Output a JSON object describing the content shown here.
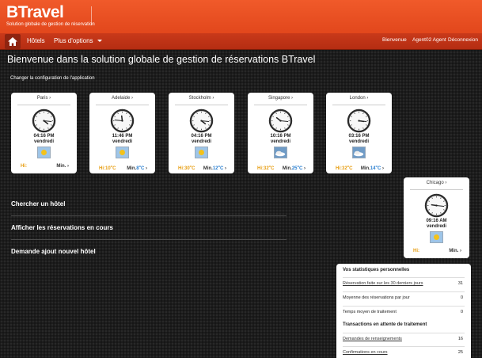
{
  "header": {
    "logo_text": "BTravel",
    "logo_tagline": "Solution globale de gestion de réservation"
  },
  "nav": {
    "hotels": "Hôtels",
    "more": "Plus d'options",
    "welcome": "Bienvenue",
    "user": "Agent02 Agent",
    "logout": "Déconnexion"
  },
  "page": {
    "title": "Bienvenue dans la solution globale de gestion de réservations BTravel",
    "config_link": "Changer la configuration de l'application"
  },
  "clocks": [
    {
      "city": "Paris",
      "time": "04:16 PM",
      "day": "vendredi",
      "hi": "Hi:",
      "min": "Min.",
      "hour": 4,
      "minute": 16,
      "weather": "sun-icon"
    },
    {
      "city": "Adelaide",
      "time": "11:46 PM",
      "day": "vendredi",
      "hi": "Hi:10",
      "min": "Min.8",
      "hour": 11,
      "minute": 46,
      "weather": "moon-icon"
    },
    {
      "city": "Stockholm",
      "time": "04:16 PM",
      "day": "vendredi",
      "hi": "Hi:30",
      "min": "Min.12",
      "hour": 4,
      "minute": 16,
      "weather": "sun-icon"
    },
    {
      "city": "Singapore",
      "time": "10:16 PM",
      "day": "vendredi",
      "hi": "Hi:32",
      "min": "Min.25",
      "hour": 10,
      "minute": 16,
      "weather": "cloud-icon"
    },
    {
      "city": "London",
      "time": "03:16 PM",
      "day": "vendredi",
      "hi": "Hi:32",
      "min": "Min.14",
      "hour": 3,
      "minute": 16,
      "weather": "cloud-icon"
    },
    {
      "city": "Chicago",
      "time": "09:16 AM",
      "day": "vendredi",
      "hi": "Hi:",
      "min": "Min.",
      "hour": 9,
      "minute": 16,
      "weather": "sun-icon"
    }
  ],
  "temp_unit": "C",
  "menu": {
    "search_hotel": "Chercher un hôtel",
    "show_reservations": "Afficher les réservations en cours",
    "add_hotel": "Demande ajout nouvel hôtel"
  },
  "stats": {
    "title": "Vos statistiques personnelles",
    "rows": [
      {
        "label": "Réservation faite sur les 30 derniers jours",
        "value": "31"
      },
      {
        "label": "Moyenne des réservations par jour",
        "value": "0"
      },
      {
        "label": "Temps moyen de traitement",
        "value": "0"
      }
    ],
    "pending_title": "Transactions en attente de traitement",
    "pending": [
      {
        "label": "Demandes de renseignements",
        "value": "16"
      },
      {
        "label": "Confirmations en cours",
        "value": "25"
      }
    ]
  },
  "colors": {
    "brand": "#e94e22",
    "nav": "#bf3317",
    "hi_temp": "#e79d10",
    "min_temp": "#2a7fd0"
  }
}
